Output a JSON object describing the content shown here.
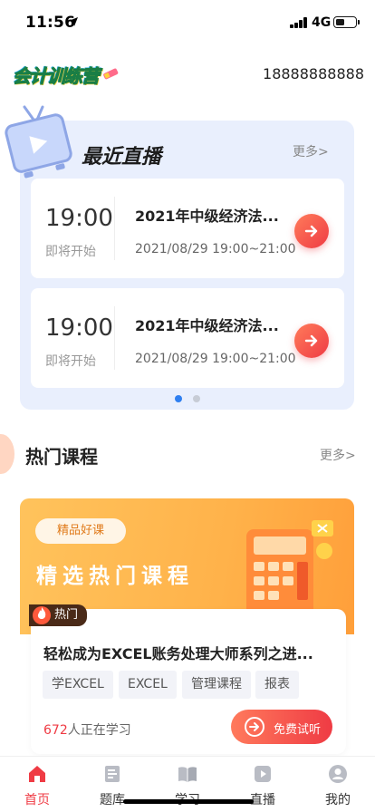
{
  "status_bar": {
    "time": "11:56",
    "network": "4G",
    "battery_level": 0.45
  },
  "header": {
    "logo_text": "会计训练营",
    "phone": "18888888888"
  },
  "live": {
    "title": "最近直播",
    "more": "更多>",
    "items": [
      {
        "time": "19:00",
        "status": "即将开始",
        "title": "2021年中级经济法...",
        "range": "2021/08/29 19:00~21:00"
      },
      {
        "time": "19:00",
        "status": "即将开始",
        "title": "2021年中级经济法...",
        "range": "2021/08/29 19:00~21:00"
      }
    ],
    "pager": {
      "count": 2,
      "active": 0
    }
  },
  "hot": {
    "title": "热门课程",
    "more": "更多>",
    "banner": {
      "badge": "精品好课",
      "title": "精选热门课程"
    },
    "course": {
      "tag": "热门",
      "title": "轻松成为EXCEL账务处理大师系列之进...",
      "tags": [
        "学EXCEL",
        "EXCEL",
        "管理课程",
        "报表"
      ],
      "learner_count": "672",
      "learner_suffix": "人正在学习",
      "trial_button": "免费试听"
    }
  },
  "tabs": [
    {
      "label": "首页",
      "icon": "home-icon",
      "active": true
    },
    {
      "label": "题库",
      "icon": "question-bank-icon",
      "active": false
    },
    {
      "label": "学习",
      "icon": "book-icon",
      "active": false
    },
    {
      "label": "直播",
      "icon": "play-icon",
      "active": false
    },
    {
      "label": "我的",
      "icon": "user-icon",
      "active": false
    }
  ],
  "colors": {
    "accent": "#ef3b44",
    "live_card_bg": "#e9effd",
    "banner": "#ffb24a",
    "pager_active": "#2f7ff0",
    "pager_inactive": "#c7ccd6"
  }
}
